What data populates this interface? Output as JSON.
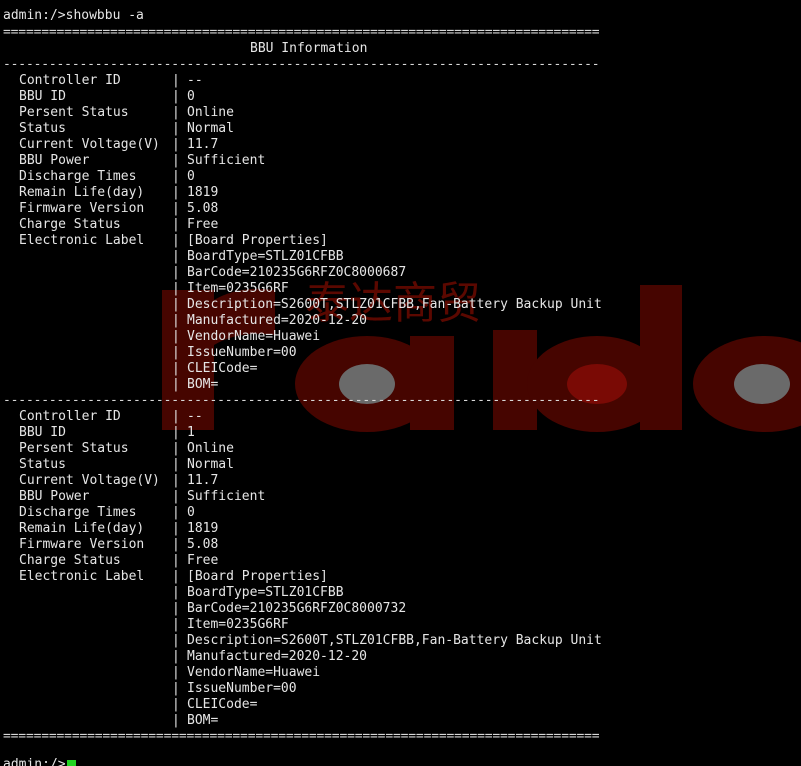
{
  "terminal": {
    "command_line": "admin:/>showbbu -a",
    "separator_double": "==============================================================================",
    "separator_single": "------------------------------------------------------------------------------",
    "title": "BBU Information",
    "prompt_fragment": "admin:/>",
    "cursor_color": "#21d421",
    "bar": "|"
  },
  "watermark": {
    "chinese_text": "泰达商贸",
    "latin_text": "raida",
    "color": "#6b0a00"
  },
  "bbu_blocks": [
    {
      "fields": [
        {
          "key": "Controller ID",
          "value": "--"
        },
        {
          "key": "BBU ID",
          "value": "0"
        },
        {
          "key": "Persent Status",
          "value": "Online"
        },
        {
          "key": "Status",
          "value": "Normal"
        },
        {
          "key": "Current Voltage(V)",
          "value": "11.7"
        },
        {
          "key": "BBU Power",
          "value": "Sufficient"
        },
        {
          "key": "Discharge Times",
          "value": "0"
        },
        {
          "key": "Remain Life(day)",
          "value": "1819"
        },
        {
          "key": "Firmware Version",
          "value": "5.08"
        },
        {
          "key": "Charge Status",
          "value": "Free"
        },
        {
          "key": "Electronic Label",
          "value": "[Board Properties]"
        }
      ],
      "label_lines": [
        "BoardType=STLZ01CFBB",
        "BarCode=210235G6RFZ0C8000687",
        "Item=0235G6RF",
        "Description=S2600T,STLZ01CFBB,Fan-Battery Backup Unit",
        "Manufactured=2020-12-20",
        "VendorName=Huawei",
        "IssueNumber=00",
        "CLEICode=",
        "BOM="
      ]
    },
    {
      "fields": [
        {
          "key": "Controller ID",
          "value": "--"
        },
        {
          "key": "BBU ID",
          "value": "1"
        },
        {
          "key": "Persent Status",
          "value": "Online"
        },
        {
          "key": "Status",
          "value": "Normal"
        },
        {
          "key": "Current Voltage(V)",
          "value": "11.7"
        },
        {
          "key": "BBU Power",
          "value": "Sufficient"
        },
        {
          "key": "Discharge Times",
          "value": "0"
        },
        {
          "key": "Remain Life(day)",
          "value": "1819"
        },
        {
          "key": "Firmware Version",
          "value": "5.08"
        },
        {
          "key": "Charge Status",
          "value": "Free"
        },
        {
          "key": "Electronic Label",
          "value": "[Board Properties]"
        }
      ],
      "label_lines": [
        "BoardType=STLZ01CFBB",
        "BarCode=210235G6RFZ0C8000732",
        "Item=0235G6RF",
        "Description=S2600T,STLZ01CFBB,Fan-Battery Backup Unit",
        "Manufactured=2020-12-20",
        "VendorName=Huawei",
        "IssueNumber=00",
        "CLEICode=",
        "BOM="
      ]
    }
  ]
}
